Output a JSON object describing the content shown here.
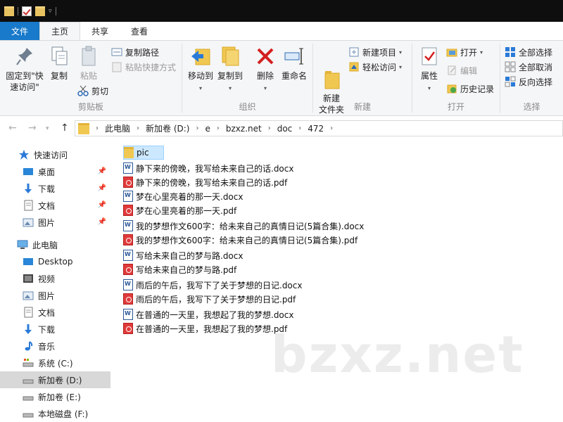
{
  "titlebar": {
    "icons": [
      "folder-icon",
      "properties-icon",
      "folder-icon",
      "dropdown-icon"
    ]
  },
  "tabs": [
    {
      "label": "文件"
    },
    {
      "label": "主页"
    },
    {
      "label": "共享"
    },
    {
      "label": "查看"
    }
  ],
  "ribbon": {
    "clipboard": {
      "pin_label": "固定到\"快\n速访问\"",
      "copy_label": "复制",
      "paste_label": "粘贴",
      "copy_path_label": "复制路径",
      "paste_shortcut_label": "粘贴快捷方式",
      "cut_label": "剪切",
      "group_label": "剪贴板"
    },
    "organize": {
      "move_to_label": "移动到",
      "copy_to_label": "复制到",
      "delete_label": "删除",
      "rename_label": "重命名",
      "group_label": "组织"
    },
    "new": {
      "new_folder_label": "新建\n文件夹",
      "new_item_label": "新建项目",
      "easy_access_label": "轻松访问",
      "group_label": "新建"
    },
    "open": {
      "properties_label": "属性",
      "open_label": "打开",
      "edit_label": "编辑",
      "history_label": "历史记录",
      "group_label": "打开"
    },
    "select": {
      "select_all_label": "全部选择",
      "select_none_label": "全部取消",
      "invert_label": "反向选择",
      "group_label": "选择"
    }
  },
  "address": {
    "crumbs": [
      "此电脑",
      "新加卷 (D:)",
      "e",
      "bzxz.net",
      "doc",
      "472"
    ]
  },
  "navpane": {
    "items": [
      {
        "label": "快速访问",
        "icon": "star-icon"
      },
      {
        "label": "桌面",
        "icon": "desktop-icon",
        "pinned": true
      },
      {
        "label": "下载",
        "icon": "download-icon",
        "pinned": true
      },
      {
        "label": "文档",
        "icon": "documents-icon",
        "pinned": true
      },
      {
        "label": "图片",
        "icon": "pictures-icon",
        "pinned": true
      },
      {
        "label": "此电脑",
        "icon": "computer-icon"
      },
      {
        "label": "Desktop",
        "icon": "desktop-icon"
      },
      {
        "label": "视频",
        "icon": "videos-icon"
      },
      {
        "label": "图片",
        "icon": "pictures-icon"
      },
      {
        "label": "文档",
        "icon": "documents-icon"
      },
      {
        "label": "下载",
        "icon": "download-icon"
      },
      {
        "label": "音乐",
        "icon": "music-icon"
      },
      {
        "label": "系统 (C:)",
        "icon": "drive-icon"
      },
      {
        "label": "新加卷 (D:)",
        "icon": "drive-icon",
        "selected": true
      },
      {
        "label": "新加卷 (E:)",
        "icon": "drive-icon"
      },
      {
        "label": "本地磁盘 (F:)",
        "icon": "drive-icon"
      }
    ]
  },
  "files": [
    {
      "name": "pic",
      "type": "folder"
    },
    {
      "name": "静下来的傍晚，我写给未来自己的话.docx",
      "type": "docx"
    },
    {
      "name": "静下来的傍晚，我写给未来自己的话.pdf",
      "type": "pdf"
    },
    {
      "name": "梦在心里亮着的那一天.docx",
      "type": "docx"
    },
    {
      "name": "梦在心里亮着的那一天.pdf",
      "type": "pdf"
    },
    {
      "name": "我的梦想作文600字：给未来自己的真情日记(5篇合集).docx",
      "type": "docx"
    },
    {
      "name": "我的梦想作文600字：给未来自己的真情日记(5篇合集).pdf",
      "type": "pdf"
    },
    {
      "name": "写给未来自己的梦与路.docx",
      "type": "docx"
    },
    {
      "name": "写给未来自己的梦与路.pdf",
      "type": "pdf"
    },
    {
      "name": "雨后的午后，我写下了关于梦想的日记.docx",
      "type": "docx"
    },
    {
      "name": "雨后的午后，我写下了关于梦想的日记.pdf",
      "type": "pdf"
    },
    {
      "name": "在普通的一天里，我想起了我的梦想.docx",
      "type": "docx"
    },
    {
      "name": "在普通的一天里，我想起了我的梦想.pdf",
      "type": "pdf"
    }
  ],
  "watermark": "bzxz.net",
  "colors": {
    "file_tab": "#1979ca",
    "selection": "#cce8ff",
    "nav_selected": "#d8d8d8"
  }
}
